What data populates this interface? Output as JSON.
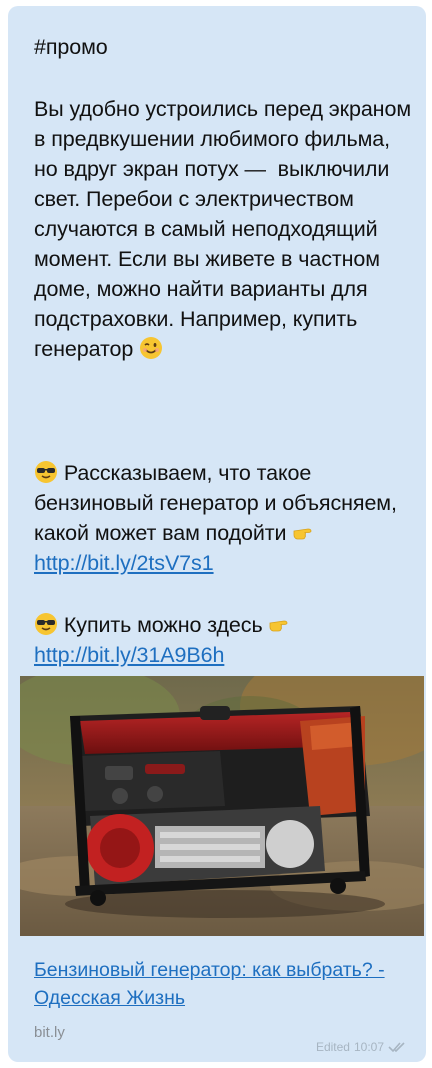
{
  "message": {
    "hashtag": "#промо",
    "paragraph1": "Вы удобно устроились перед экраном в предвкушении любимого фильма, но вдруг экран потух —  выключили свет. Перебои с электричеством случаются в самый неподходящий момент. Если вы живете в частном доме, можно найти варианты для подстраховки. Например, купить генератор",
    "paragraph1_emoji": "winking-face-icon",
    "paragraph2_text": "Рассказываем, что такое бензиновый генератор и объясняем, какой может вам подойти",
    "paragraph2_link": "http://bit.ly/2tsV7s1",
    "paragraph2_emojis": [
      "sunglasses-face-icon",
      "pointing-hand-icon"
    ],
    "paragraph3_text": "Купить можно здесь",
    "paragraph3_link": "http://bit.ly/31A9B6h",
    "paragraph3_emojis": [
      "sunglasses-face-icon",
      "pointing-hand-icon"
    ]
  },
  "link_preview": {
    "title": "Бензиновый генератор: как выбрать? - Одесская Жизнь",
    "site": "bit.ly",
    "image": "generator-photo"
  },
  "meta": {
    "edited_label": "Edited",
    "time": "10:07",
    "status_icon": "double-check-icon"
  },
  "colors": {
    "bubble_bg": "#d6e6f6",
    "link": "#1e6fc0",
    "meta": "#a7b5c2"
  }
}
